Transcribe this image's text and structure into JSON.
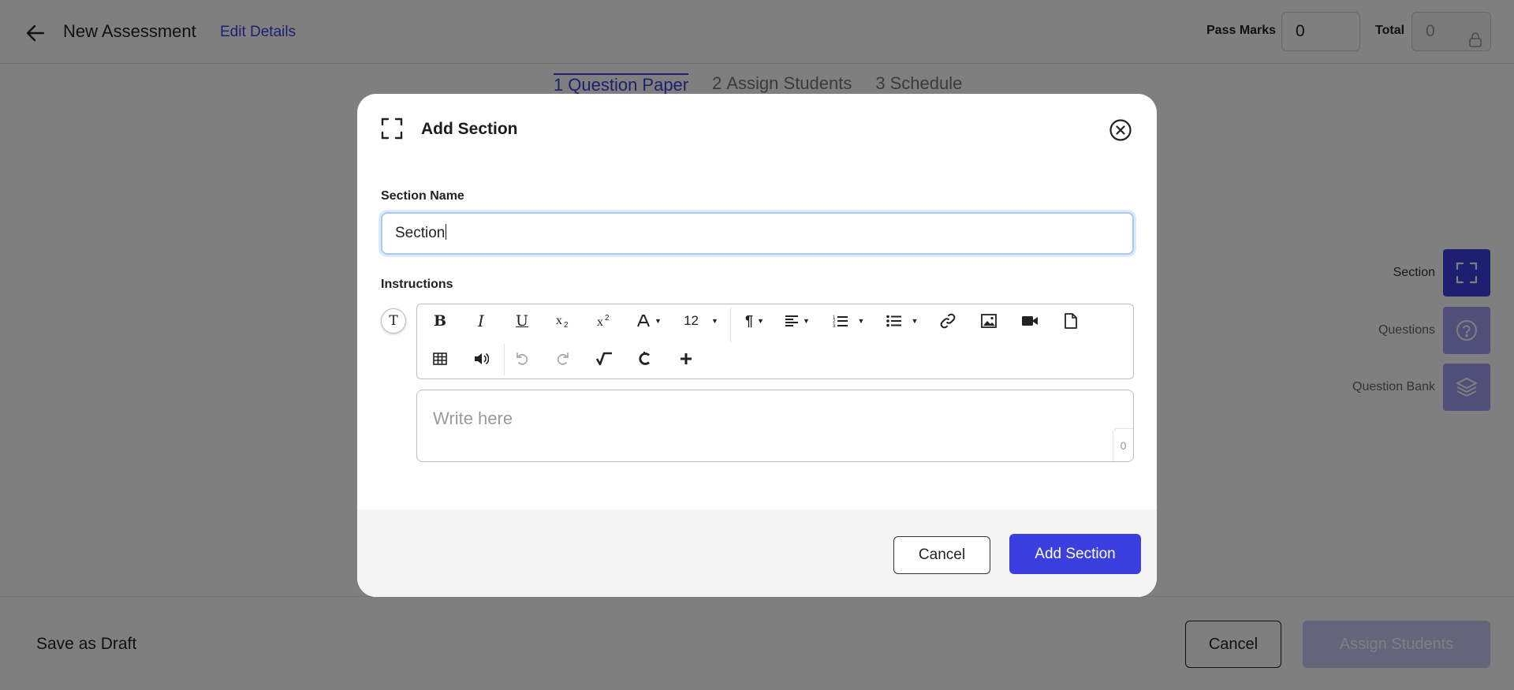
{
  "header": {
    "title": "New Assessment",
    "edit_link": "Edit Details",
    "pass_marks_label": "Pass Marks",
    "pass_marks_value": "0",
    "total_label": "Total",
    "total_value": "0"
  },
  "steps": [
    {
      "num": "1",
      "label": "Question Paper"
    },
    {
      "num": "2",
      "label": "Assign Students"
    },
    {
      "num": "3",
      "label": "Schedule"
    }
  ],
  "side_tools": {
    "section_label": "Section",
    "questions_label": "Questions",
    "bank_label": "Question Bank"
  },
  "footer": {
    "draft": "Save as Draft",
    "cancel": "Cancel",
    "assign": "Assign Students"
  },
  "modal": {
    "title": "Add Section",
    "name_label": "Section Name",
    "name_value": "Section",
    "instructions_label": "Instructions",
    "format_badge": "T",
    "toolbar": {
      "bold": "B",
      "italic": "I",
      "underline": "U",
      "font_size": "12"
    },
    "editor_placeholder": "Write here",
    "char_count": "0",
    "cancel": "Cancel",
    "submit": "Add Section"
  },
  "colors": {
    "accent": "#3b3fe0",
    "accent_soft": "#9e9ff2",
    "focus_border": "#a9c8f0"
  }
}
